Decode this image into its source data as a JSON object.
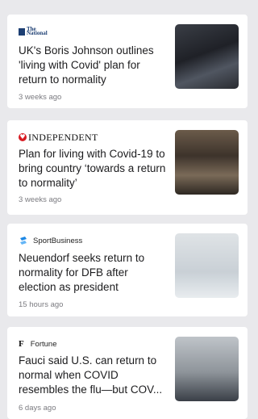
{
  "articles": [
    {
      "source": "The National",
      "headline_lines": [
        "UK's Boris Johnson outlines",
        "'living with Covid' plan for"
      ],
      "line3_pre": "return to ",
      "highlight": "normality",
      "line3_post": "",
      "time": "3 weeks ago"
    },
    {
      "source": "INDEPENDENT",
      "headline_lines": [
        "Plan for living with Covid-19 to",
        "bring country ‘towards a return"
      ],
      "line3_pre": "to ",
      "highlight": "normality’",
      "line3_post": "",
      "time": "3 weeks ago"
    },
    {
      "source": "SportBusiness",
      "line1": "Neuendorf seeks return to",
      "highlight": "normality",
      "line2_post": " for DFB after",
      "line3": "election as president",
      "time": "15 hours ago"
    },
    {
      "source": "Fortune",
      "line1": "Fauci said U.S. can return to",
      "highlight": "normal",
      "line2_post": " when COVID",
      "line3": "resembles the flu—but COV...",
      "time": "6 days ago"
    }
  ],
  "accent_color": "#e0561a"
}
